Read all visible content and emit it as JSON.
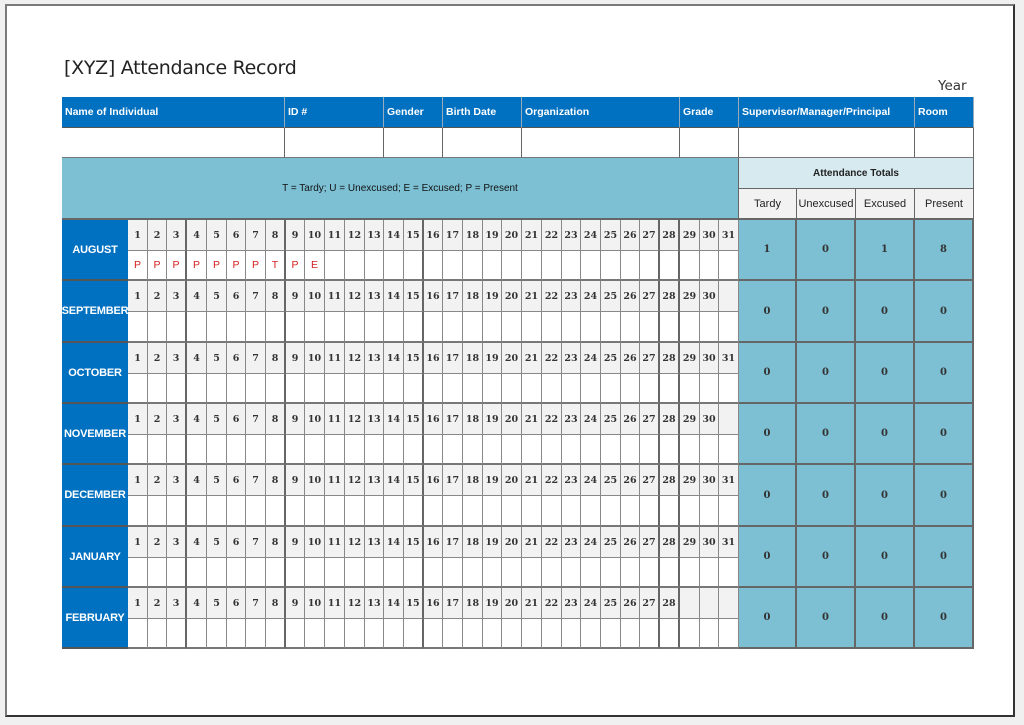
{
  "document": {
    "title": "[XYZ] Attendance Record",
    "year_label": "Year"
  },
  "info_header": {
    "columns": [
      {
        "key": "name",
        "label": "Name of Individual",
        "value": ""
      },
      {
        "key": "id",
        "label": "ID #",
        "value": ""
      },
      {
        "key": "gender",
        "label": "Gender",
        "value": ""
      },
      {
        "key": "birth_date",
        "label": "Birth Date",
        "value": ""
      },
      {
        "key": "organization",
        "label": "Organization",
        "value": ""
      },
      {
        "key": "grade",
        "label": "Grade",
        "value": ""
      },
      {
        "key": "supervisor",
        "label": "Supervisor/Manager/Principal",
        "value": ""
      },
      {
        "key": "room",
        "label": "Room",
        "value": ""
      }
    ]
  },
  "legend": "T = Tardy; U = Unexcused; E = Excused; P = Present",
  "totals_header": {
    "title": "Attendance Totals",
    "columns": [
      "Tardy",
      "Unexcused",
      "Excused",
      "Present"
    ]
  },
  "months": [
    {
      "name": "AUGUST",
      "days": 31,
      "marks": [
        "P",
        "P",
        "P",
        "P",
        "P",
        "P",
        "P",
        "T",
        "P",
        "E"
      ],
      "totals": {
        "tardy": "1",
        "unexcused": "0",
        "excused": "1",
        "present": "8"
      }
    },
    {
      "name": "SEPTEMBER",
      "days": 30,
      "marks": [],
      "totals": {
        "tardy": "0",
        "unexcused": "0",
        "excused": "0",
        "present": "0"
      }
    },
    {
      "name": "OCTOBER",
      "days": 31,
      "marks": [],
      "totals": {
        "tardy": "0",
        "unexcused": "0",
        "excused": "0",
        "present": "0"
      }
    },
    {
      "name": "NOVEMBER",
      "days": 30,
      "marks": [],
      "totals": {
        "tardy": "0",
        "unexcused": "0",
        "excused": "0",
        "present": "0"
      }
    },
    {
      "name": "DECEMBER",
      "days": 31,
      "marks": [],
      "totals": {
        "tardy": "0",
        "unexcused": "0",
        "excused": "0",
        "present": "0"
      }
    },
    {
      "name": "JANUARY",
      "days": 31,
      "marks": [],
      "totals": {
        "tardy": "0",
        "unexcused": "0",
        "excused": "0",
        "present": "0"
      }
    },
    {
      "name": "FEBRUARY",
      "days": 28,
      "marks": [],
      "totals": {
        "tardy": "0",
        "unexcused": "0",
        "excused": "0",
        "present": "0"
      }
    }
  ]
}
